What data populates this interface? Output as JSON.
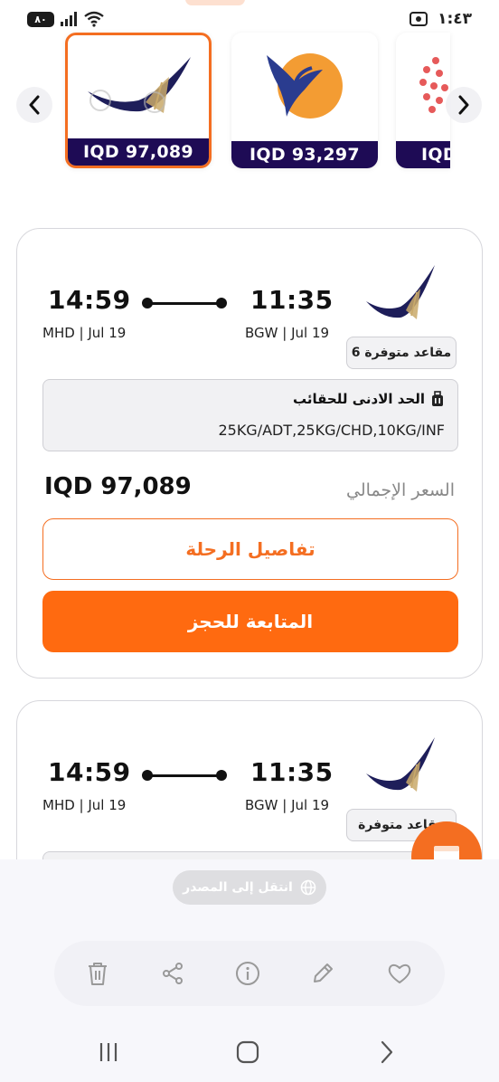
{
  "status_bar": {
    "battery": "٨٠",
    "time": "١:٤٣"
  },
  "carousel": {
    "cards": [
      {
        "price": "IQD 97,089"
      },
      {
        "price": "IQD 93,297"
      },
      {
        "price": "IQD"
      }
    ]
  },
  "flights": [
    {
      "departure_time": "11:35",
      "departure_airport": "BGW | Jul 19",
      "arrival_time": "14:59",
      "arrival_airport": "MHD | Jul 19",
      "seats": "6 مقاعد متوفرة",
      "baggage_title": "الحد الادنى للحقائب",
      "baggage_value": "25KG/ADT,25KG/CHD,10KG/INF",
      "total_label": "السعر الإجمالي",
      "total_price": "IQD 97,089",
      "details_label": "تفاصيل الرحلة",
      "book_label": "المتابعة للحجز"
    },
    {
      "departure_time": "11:35",
      "departure_airport": "BGW | Jul 19",
      "arrival_time": "14:59",
      "arrival_airport": "MHD | Jul 19",
      "seats": "مقاعد متوفرة"
    }
  ],
  "gallery": {
    "source_chip": "انتقل إلى المصدر"
  },
  "colors": {
    "accent": "#f46e21",
    "band": "#1e0b55",
    "book_button": "#ff6a10"
  }
}
